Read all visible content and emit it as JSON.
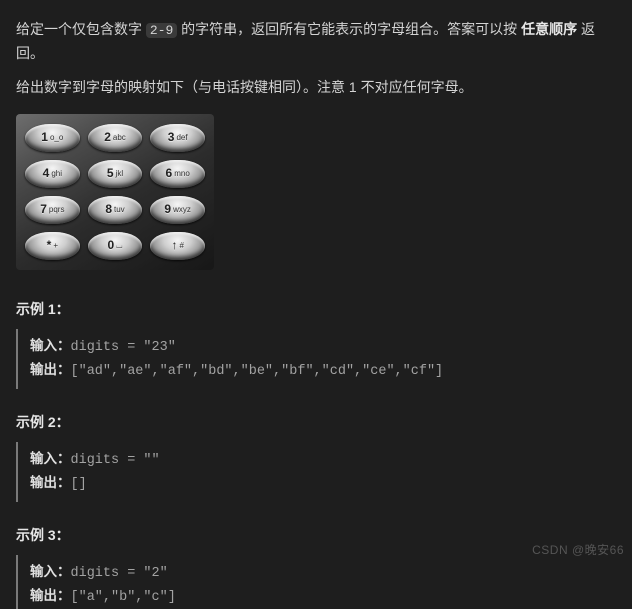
{
  "description": {
    "line1_pre": "给定一个仅包含数字 ",
    "chip": "2-9",
    "line1_post": " 的字符串，返回所有它能表示的字母组合。答案可以按 ",
    "bold1": "任意顺序",
    "line1_end": " 返回。",
    "line2": "给出数字到字母的映射如下（与电话按键相同）。注意 1 不对应任何字母。"
  },
  "keypad": [
    {
      "digit": "1",
      "letters": "o_o"
    },
    {
      "digit": "2",
      "letters": "abc"
    },
    {
      "digit": "3",
      "letters": "def"
    },
    {
      "digit": "4",
      "letters": "ghi"
    },
    {
      "digit": "5",
      "letters": "jkl"
    },
    {
      "digit": "6",
      "letters": "mno"
    },
    {
      "digit": "7",
      "letters": "pqrs"
    },
    {
      "digit": "8",
      "letters": "tuv"
    },
    {
      "digit": "9",
      "letters": "wxyz"
    },
    {
      "digit": "*",
      "letters": "+"
    },
    {
      "digit": "0",
      "letters": "⌴"
    },
    {
      "digit": "↑",
      "letters": "#"
    }
  ],
  "labels": {
    "example1": "示例 1：",
    "example2": "示例 2：",
    "example3": "示例 3：",
    "input": "输入：",
    "output": "输出："
  },
  "examples": {
    "e1": {
      "input": "digits = \"23\"",
      "output": "[\"ad\",\"ae\",\"af\",\"bd\",\"be\",\"bf\",\"cd\",\"ce\",\"cf\"]"
    },
    "e2": {
      "input": "digits = \"\"",
      "output": "[]"
    },
    "e3": {
      "input": "digits = \"2\"",
      "output": "[\"a\",\"b\",\"c\"]"
    }
  },
  "watermark": "CSDN @晚安66"
}
